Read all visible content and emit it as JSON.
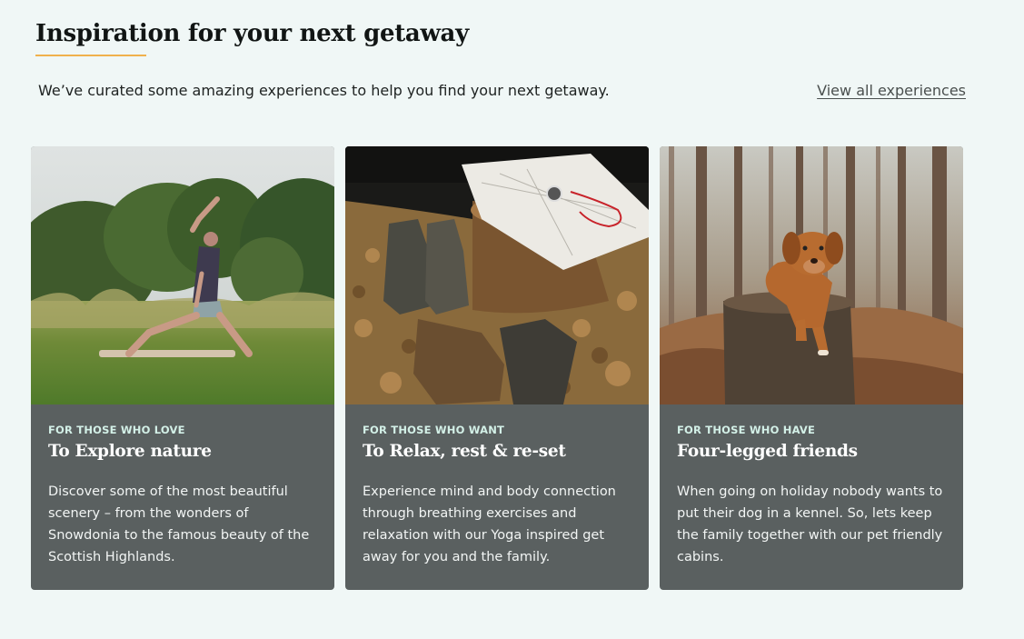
{
  "header": {
    "title": "Inspiration for your next getaway",
    "intro": "We’ve curated some amazing experiences to help you find your next getaway.",
    "view_all_label": "View all experiences"
  },
  "colors": {
    "background": "#f0f7f6",
    "accent_underline": "#f0b14d",
    "card_background": "#5a6060",
    "eyebrow": "#d3f0e7"
  },
  "cards": [
    {
      "eyebrow": "FOR THOSE WHO LOVE",
      "title": "To Explore nature",
      "description": "Discover some of the most beautiful scenery – from the wonders of Snowdonia to the famous beauty of the Scottish Highlands.",
      "image": "man doing yoga pose in a grassy meadow"
    },
    {
      "eyebrow": "FOR THOSE WHO WANT",
      "title": "To Relax, rest & re-set",
      "description": "Experience mind and body connection through breathing exercises and relaxation with our Yoga inspired get away for you and the family.",
      "image": "hiking boots beside a tree stump with a map and compass"
    },
    {
      "eyebrow": "FOR THOSE WHO HAVE",
      "title": "Four-legged friends",
      "description": "When going on holiday nobody wants to put their dog in a kennel. So, lets keep the family together with our pet friendly cabins.",
      "image": "dog lying on a tree stump in a pine forest"
    }
  ]
}
